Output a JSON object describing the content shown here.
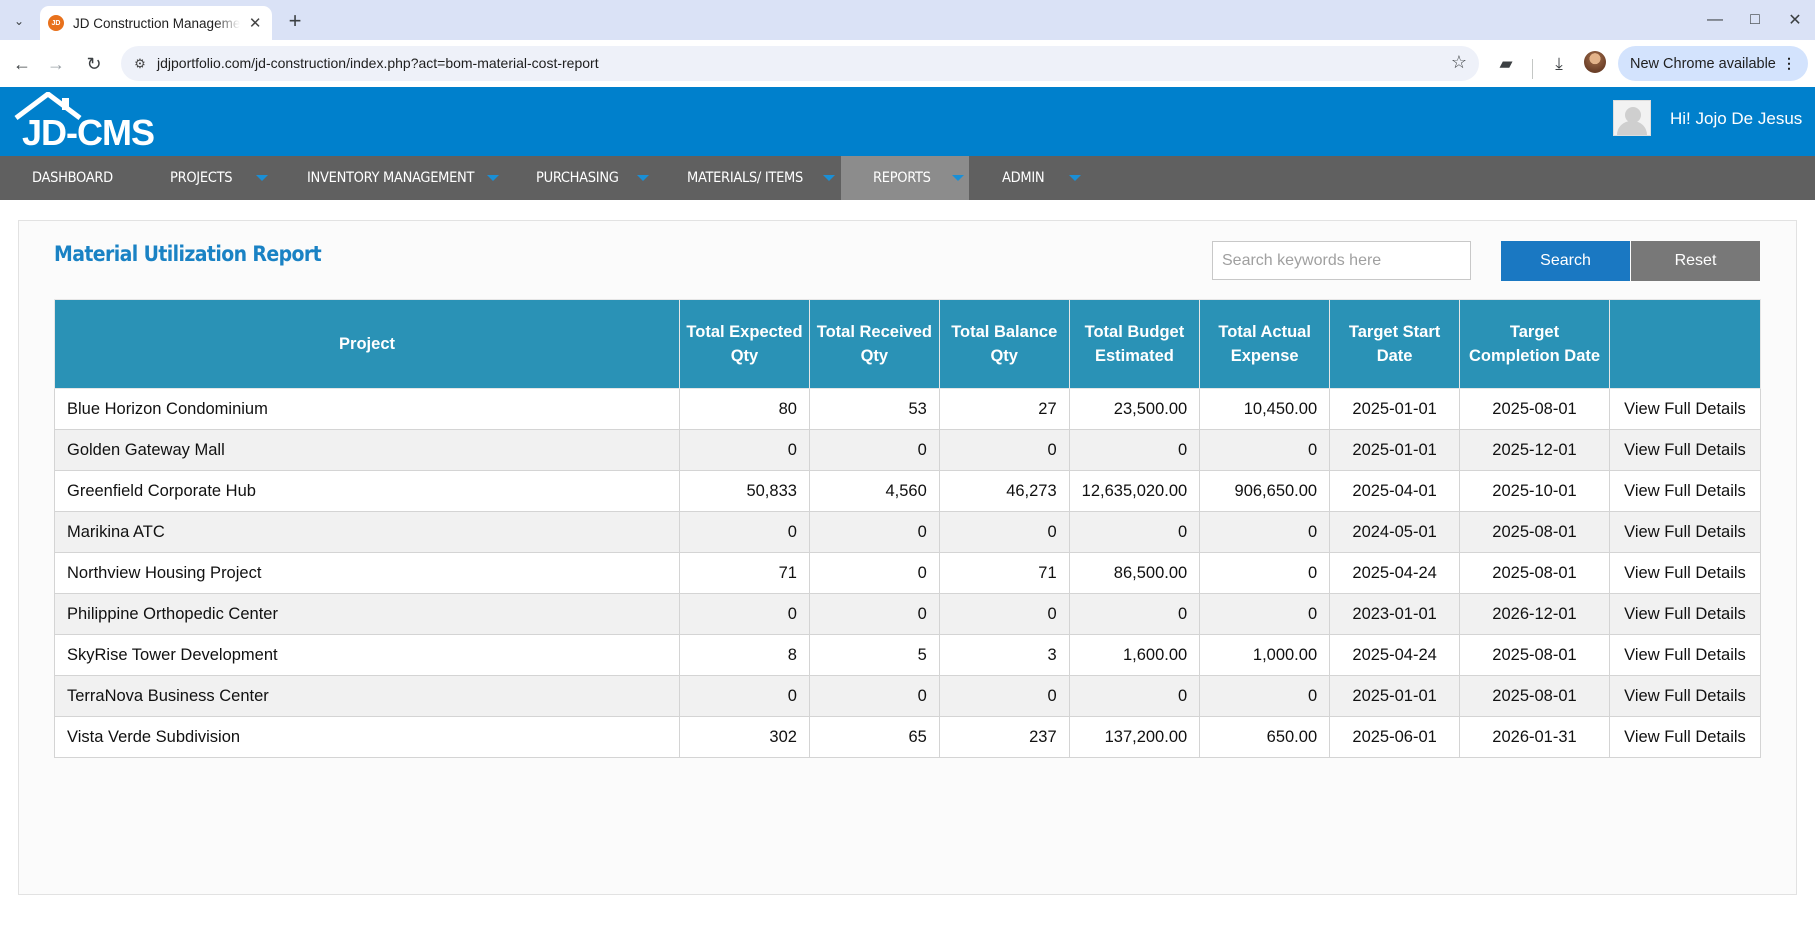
{
  "browser": {
    "tab_title": "JD Construction Management",
    "tab_favicon_text": "JD",
    "url": "jdjportfolio.com/jd-construction/index.php?act=bom-material-cost-report",
    "new_chrome_label": "New Chrome available"
  },
  "header": {
    "logo_text": "JD-CMS",
    "greeting": "Hi! Jojo De Jesus"
  },
  "menu": [
    {
      "label": "DASHBOARD",
      "has_dropdown": false,
      "active": false
    },
    {
      "label": "PROJECTS",
      "has_dropdown": true,
      "active": false
    },
    {
      "label": "INVENTORY MANAGEMENT",
      "has_dropdown": true,
      "active": false
    },
    {
      "label": "PURCHASING",
      "has_dropdown": true,
      "active": false
    },
    {
      "label": "MATERIALS/ ITEMS",
      "has_dropdown": true,
      "active": false
    },
    {
      "label": "REPORTS",
      "has_dropdown": true,
      "active": true
    },
    {
      "label": "ADMIN",
      "has_dropdown": true,
      "active": false
    }
  ],
  "report": {
    "title": "Material Utilization Report",
    "search_placeholder": "Search keywords here",
    "search_value": "",
    "search_button": "Search",
    "reset_button": "Reset"
  },
  "table": {
    "headers": [
      "Project",
      "Total Expected Qty",
      "Total Received Qty",
      "Total Balance Qty",
      "Total Budget Estimated",
      "Total Actual Expense",
      "Target Start Date",
      "Target Completion Date",
      ""
    ],
    "rows": [
      {
        "project": "Blue Horizon Condominium",
        "expected": "80",
        "received": "53",
        "balance": "27",
        "budget": "23,500.00",
        "expense": "10,450.00",
        "start": "2025-01-01",
        "completion": "2025-08-01",
        "action": "View Full Details"
      },
      {
        "project": "Golden Gateway Mall",
        "expected": "0",
        "received": "0",
        "balance": "0",
        "budget": "0",
        "expense": "0",
        "start": "2025-01-01",
        "completion": "2025-12-01",
        "action": "View Full Details"
      },
      {
        "project": "Greenfield Corporate Hub",
        "expected": "50,833",
        "received": "4,560",
        "balance": "46,273",
        "budget": "12,635,020.00",
        "expense": "906,650.00",
        "start": "2025-04-01",
        "completion": "2025-10-01",
        "action": "View Full Details"
      },
      {
        "project": "Marikina ATC",
        "expected": "0",
        "received": "0",
        "balance": "0",
        "budget": "0",
        "expense": "0",
        "start": "2024-05-01",
        "completion": "2025-08-01",
        "action": "View Full Details"
      },
      {
        "project": "Northview Housing Project",
        "expected": "71",
        "received": "0",
        "balance": "71",
        "budget": "86,500.00",
        "expense": "0",
        "start": "2025-04-24",
        "completion": "2025-08-01",
        "action": "View Full Details"
      },
      {
        "project": "Philippine Orthopedic Center",
        "expected": "0",
        "received": "0",
        "balance": "0",
        "budget": "0",
        "expense": "0",
        "start": "2023-01-01",
        "completion": "2026-12-01",
        "action": "View Full Details"
      },
      {
        "project": "SkyRise Tower Development",
        "expected": "8",
        "received": "5",
        "balance": "3",
        "budget": "1,600.00",
        "expense": "1,000.00",
        "start": "2025-04-24",
        "completion": "2025-08-01",
        "action": "View Full Details"
      },
      {
        "project": "TerraNova Business Center",
        "expected": "0",
        "received": "0",
        "balance": "0",
        "budget": "0",
        "expense": "0",
        "start": "2025-01-01",
        "completion": "2025-08-01",
        "action": "View Full Details"
      },
      {
        "project": "Vista Verde Subdivision",
        "expected": "302",
        "received": "65",
        "balance": "237",
        "budget": "137,200.00",
        "expense": "650.00",
        "start": "2025-06-01",
        "completion": "2026-01-31",
        "action": "View Full Details"
      }
    ]
  },
  "colors": {
    "header_blue": "#0080cc",
    "menu_gray": "#606060",
    "menu_active": "#8c8c8c",
    "table_header": "#2a92b6",
    "search_button": "#1a78c2",
    "reset_button": "#787878",
    "link": "#1a6496"
  }
}
